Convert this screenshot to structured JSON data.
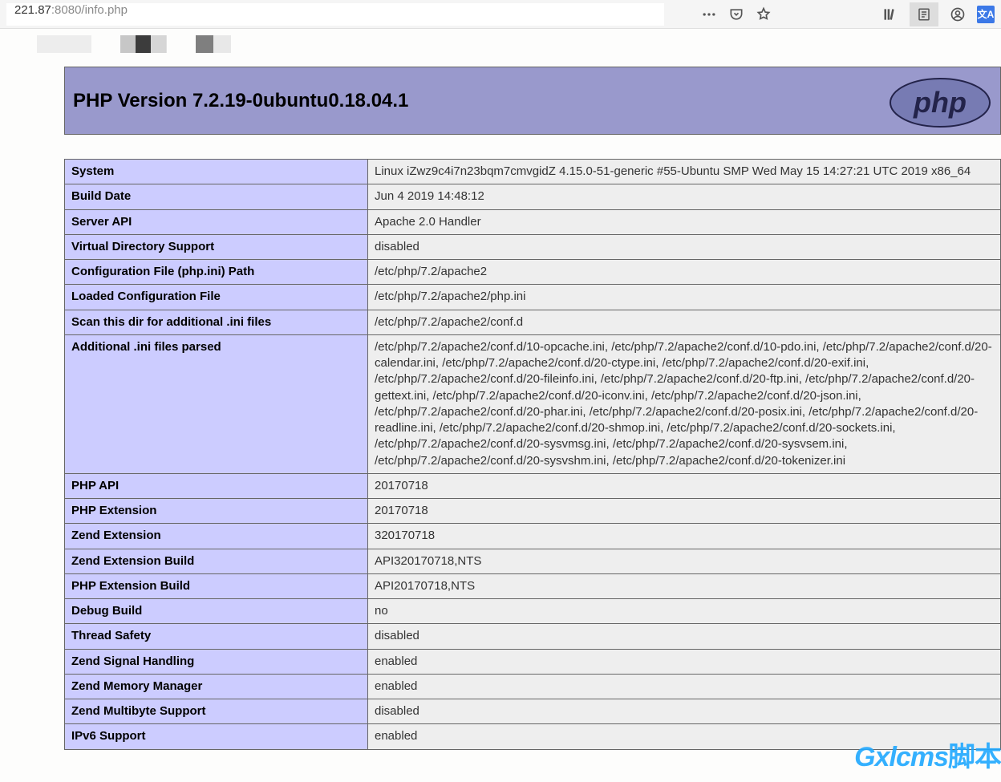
{
  "browser": {
    "url_dark": "221.87",
    "url_light": ":8080/info.php",
    "translate_label": "文A"
  },
  "header": {
    "title": "PHP Version 7.2.19-0ubuntu0.18.04.1",
    "logo_text": "php"
  },
  "rows": [
    {
      "label": "System",
      "value": "Linux iZwz9c4i7n23bqm7cmvgidZ 4.15.0-51-generic #55-Ubuntu SMP Wed May 15 14:27:21 UTC 2019 x86_64"
    },
    {
      "label": "Build Date",
      "value": "Jun 4 2019 14:48:12"
    },
    {
      "label": "Server API",
      "value": "Apache 2.0 Handler"
    },
    {
      "label": "Virtual Directory Support",
      "value": "disabled"
    },
    {
      "label": "Configuration File (php.ini) Path",
      "value": "/etc/php/7.2/apache2"
    },
    {
      "label": "Loaded Configuration File",
      "value": "/etc/php/7.2/apache2/php.ini"
    },
    {
      "label": "Scan this dir for additional .ini files",
      "value": "/etc/php/7.2/apache2/conf.d"
    },
    {
      "label": "Additional .ini files parsed",
      "value": "/etc/php/7.2/apache2/conf.d/10-opcache.ini, /etc/php/7.2/apache2/conf.d/10-pdo.ini, /etc/php/7.2/apache2/conf.d/20-calendar.ini, /etc/php/7.2/apache2/conf.d/20-ctype.ini, /etc/php/7.2/apache2/conf.d/20-exif.ini, /etc/php/7.2/apache2/conf.d/20-fileinfo.ini, /etc/php/7.2/apache2/conf.d/20-ftp.ini, /etc/php/7.2/apache2/conf.d/20-gettext.ini, /etc/php/7.2/apache2/conf.d/20-iconv.ini, /etc/php/7.2/apache2/conf.d/20-json.ini, /etc/php/7.2/apache2/conf.d/20-phar.ini, /etc/php/7.2/apache2/conf.d/20-posix.ini, /etc/php/7.2/apache2/conf.d/20-readline.ini, /etc/php/7.2/apache2/conf.d/20-shmop.ini, /etc/php/7.2/apache2/conf.d/20-sockets.ini, /etc/php/7.2/apache2/conf.d/20-sysvmsg.ini, /etc/php/7.2/apache2/conf.d/20-sysvsem.ini, /etc/php/7.2/apache2/conf.d/20-sysvshm.ini, /etc/php/7.2/apache2/conf.d/20-tokenizer.ini"
    },
    {
      "label": "PHP API",
      "value": "20170718"
    },
    {
      "label": "PHP Extension",
      "value": "20170718"
    },
    {
      "label": "Zend Extension",
      "value": "320170718"
    },
    {
      "label": "Zend Extension Build",
      "value": "API320170718,NTS"
    },
    {
      "label": "PHP Extension Build",
      "value": "API20170718,NTS"
    },
    {
      "label": "Debug Build",
      "value": "no"
    },
    {
      "label": "Thread Safety",
      "value": "disabled"
    },
    {
      "label": "Zend Signal Handling",
      "value": "enabled"
    },
    {
      "label": "Zend Memory Manager",
      "value": "enabled"
    },
    {
      "label": "Zend Multibyte Support",
      "value": "disabled"
    },
    {
      "label": "IPv6 Support",
      "value": "enabled"
    }
  ],
  "watermark": {
    "latin": "Gxlcms",
    "cn": "脚本"
  }
}
